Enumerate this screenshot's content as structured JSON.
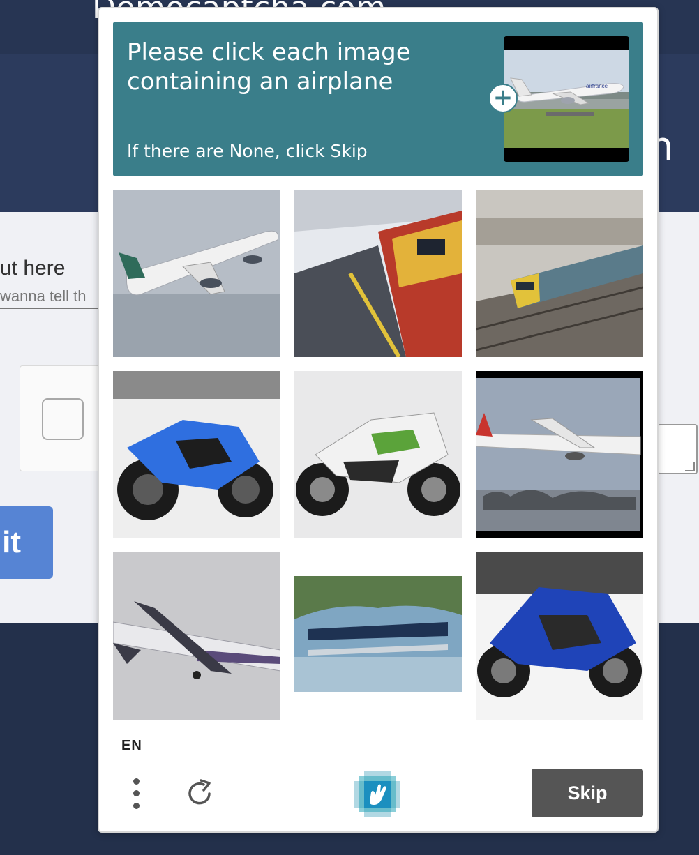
{
  "background": {
    "site_title": "Democaptcha.com",
    "hero_letter": "n",
    "field_label": "ut here",
    "field_placeholder": "wanna tell th",
    "submit_label": "it"
  },
  "captcha": {
    "prompt_title": "Please click each image containing an airplane",
    "prompt_subtitle": "If there are None, click Skip",
    "expand_label": "+",
    "tiles": [
      {
        "subject": "airplane"
      },
      {
        "subject": "train"
      },
      {
        "subject": "train"
      },
      {
        "subject": "motorcycle"
      },
      {
        "subject": "motorcycle"
      },
      {
        "subject": "airplane"
      },
      {
        "subject": "airplane"
      },
      {
        "subject": "seaplane"
      },
      {
        "subject": "motorcycle"
      }
    ],
    "language": "EN",
    "skip_label": "Skip",
    "icons": {
      "menu": "more-vertical-icon",
      "refresh": "refresh-icon",
      "logo": "hcaptcha-logo-icon"
    },
    "colors": {
      "prompt_bg": "#3a7e8a",
      "skip_bg": "#555555"
    }
  }
}
